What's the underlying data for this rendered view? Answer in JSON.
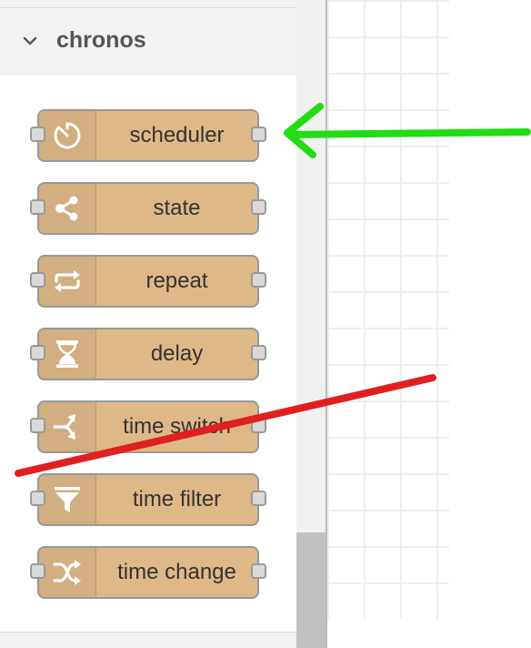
{
  "palette": {
    "category": {
      "title": "chronos",
      "expanded": true,
      "chevron_icon": "chevron-down-icon"
    },
    "node_color": "#deb887",
    "nodes": [
      {
        "label": "scheduler",
        "icon": "timer-icon"
      },
      {
        "label": "state",
        "icon": "share-nodes-icon"
      },
      {
        "label": "repeat",
        "icon": "repeat-icon"
      },
      {
        "label": "delay",
        "icon": "hourglass-icon"
      },
      {
        "label": "time switch",
        "icon": "split-arrows-icon"
      },
      {
        "label": "time filter",
        "icon": "funnel-icon"
      },
      {
        "label": "time change",
        "icon": "shuffle-icon"
      }
    ]
  },
  "annotations": {
    "green_arrow_color": "#22dd11",
    "red_line_color": "#e02020"
  }
}
